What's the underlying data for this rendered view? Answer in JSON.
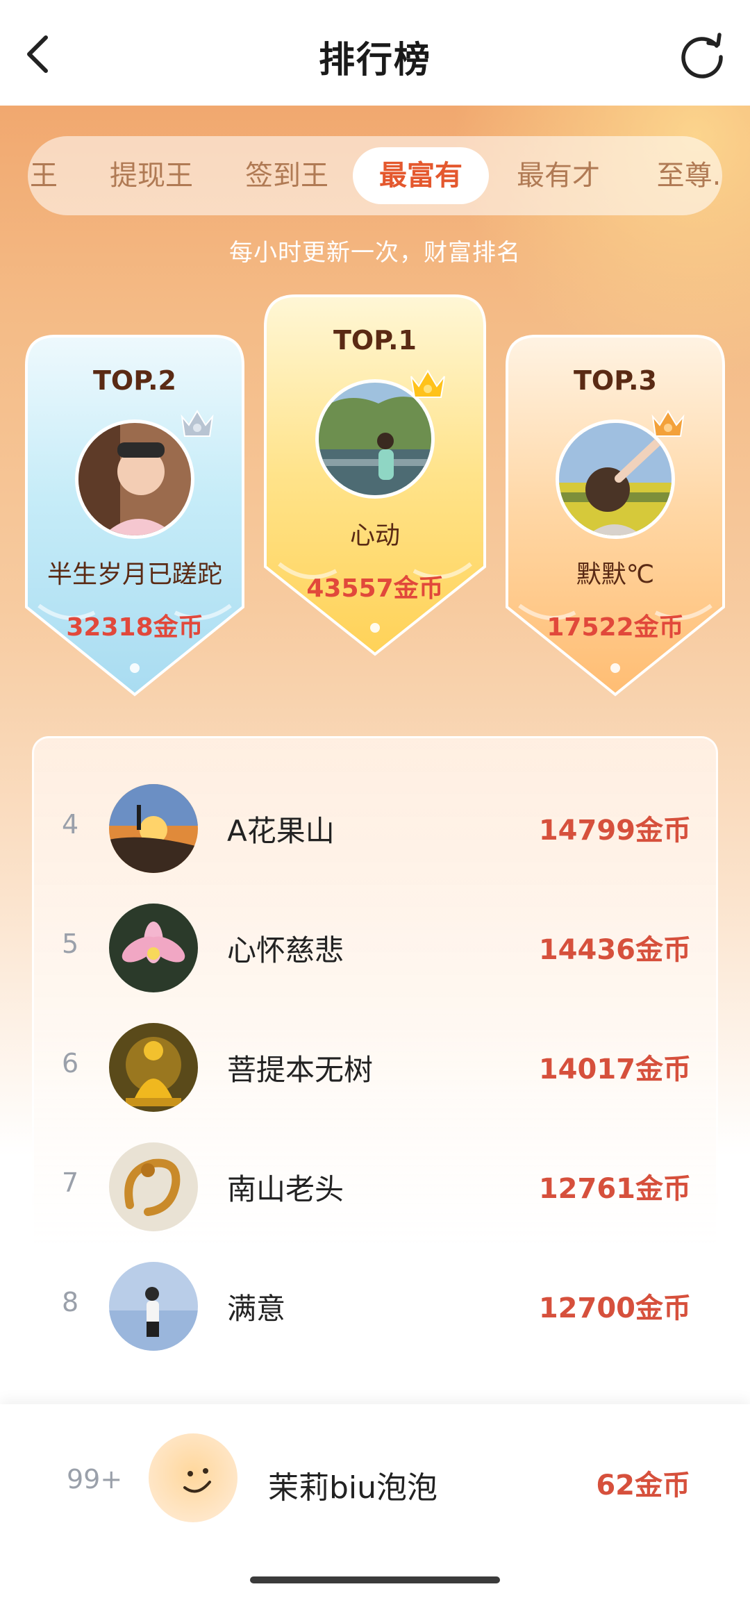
{
  "header": {
    "title": "排行榜"
  },
  "tabs": [
    "王",
    "提现王",
    "签到王",
    "最富有",
    "最有才",
    "至尊."
  ],
  "subtitle": "每小时更新一次，财富排名",
  "top3": [
    {
      "rank": "TOP.2",
      "name": "半生岁月已蹉跎",
      "coins": "32318金币",
      "color": "#bfe6f5"
    },
    {
      "rank": "TOP.1",
      "name": "心动",
      "coins": "43557金币",
      "color": "#ffd86a"
    },
    {
      "rank": "TOP.3",
      "name": "默默℃",
      "coins": "17522金币",
      "color": "#ffc98a"
    }
  ],
  "list": [
    {
      "num": "4",
      "name": "A花果山",
      "coins": "14799金币"
    },
    {
      "num": "5",
      "name": "心怀慈悲",
      "coins": "14436金币"
    },
    {
      "num": "6",
      "name": "菩提本无树",
      "coins": "14017金币"
    },
    {
      "num": "7",
      "name": "南山老头",
      "coins": "12761金币"
    },
    {
      "num": "8",
      "name": "满意",
      "coins": "12700金币"
    }
  ],
  "me": {
    "num": "99+",
    "name": "茉莉biu泡泡",
    "coins": "62金币"
  },
  "icons": {
    "back": "chevron-left-icon",
    "refresh": "refresh-icon",
    "crown": "crown-icon"
  }
}
